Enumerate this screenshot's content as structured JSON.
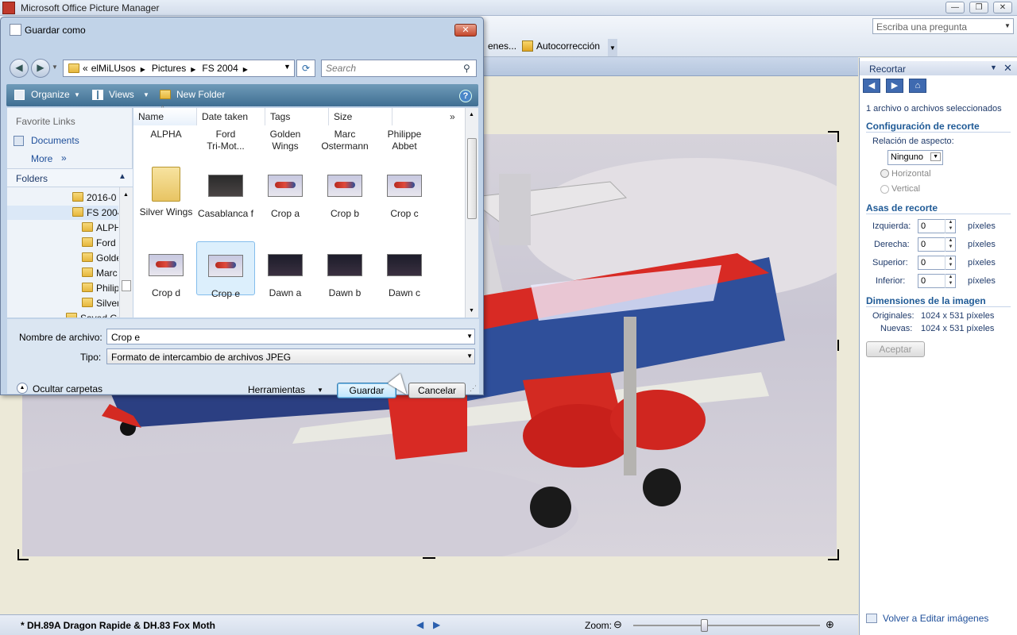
{
  "app": {
    "title": "Microsoft Office Picture Manager",
    "ask_placeholder": "Escriba una pregunta"
  },
  "toolbar": {
    "fragment_label": "enes...",
    "autocorrect_label": "Autocorrección"
  },
  "task_pane": {
    "title": "Recortar",
    "selection_text": "1 archivo o archivos seleccionados",
    "crop_settings_heading": "Configuración de recorte",
    "aspect_ratio_label": "Relación de aspecto:",
    "aspect_ratio_value": "Ninguno",
    "orientation": {
      "horizontal": "Horizontal",
      "vertical": "Vertical"
    },
    "handles_heading": "Asas de recorte",
    "handles": [
      {
        "label": "Izquierda:",
        "value": "0",
        "unit": "píxeles"
      },
      {
        "label": "Derecha:",
        "value": "0",
        "unit": "píxeles"
      },
      {
        "label": "Superior:",
        "value": "0",
        "unit": "píxeles"
      },
      {
        "label": "Inferior:",
        "value": "0",
        "unit": "píxeles"
      }
    ],
    "dimensions_heading": "Dimensiones de la imagen",
    "original_label": "Originales:",
    "original_value": "1024 x 531 píxeles",
    "new_label": "Nuevas:",
    "new_value": "1024 x 531 píxeles",
    "accept_label": "Aceptar",
    "back_link": "Volver a Editar imágenes"
  },
  "status": {
    "filename": "* DH.89A Dragon Rapide & DH.83 Fox Moth",
    "zoom_label": "Zoom:",
    "zoom_level": 0.38
  },
  "dialog": {
    "title": "Guardar como",
    "breadcrumb": [
      "«",
      "elMiLUsos",
      "Pictures",
      "FS 2004"
    ],
    "search_placeholder": "Search",
    "commands": {
      "organize": "Organize",
      "views": "Views",
      "new_folder": "New Folder"
    },
    "favorites_label": "Favorite Links",
    "favorite_items": [
      "Documents",
      "More"
    ],
    "folders_label": "Folders",
    "tree_items": [
      "2016-0",
      "FS 2004",
      "ALPH",
      "Ford",
      "Golde",
      "Marc",
      "Philip",
      "Silver",
      "Saved Ga"
    ],
    "columns": [
      "Name",
      "Date taken",
      "Tags",
      "Size"
    ],
    "top_row": [
      "ALPHA",
      "Ford\nTri-Mot...",
      "Golden\nWings",
      "Marc\nOstermann",
      "Philippe\nAbbet"
    ],
    "row2": [
      "Silver Wings",
      "Casablanca f",
      "Crop a",
      "Crop b",
      "Crop c"
    ],
    "row3": [
      "Crop d",
      "Crop e",
      "Dawn a",
      "Dawn b",
      "Dawn c"
    ],
    "filename_label": "Nombre de archivo:",
    "filename_value": "Crop e",
    "type_label": "Tipo:",
    "type_value": "Formato de intercambio de archivos JPEG",
    "hide_folders": "Ocultar carpetas",
    "tools": "Herramientas",
    "save": "Guardar",
    "cancel": "Cancelar"
  }
}
